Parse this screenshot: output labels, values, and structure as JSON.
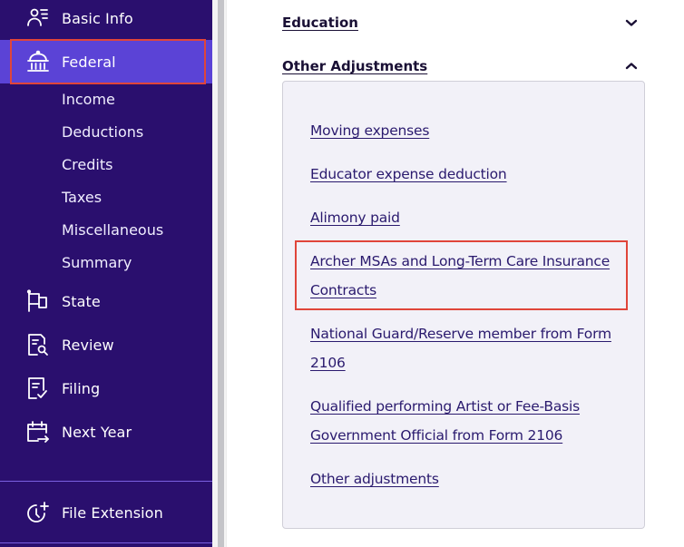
{
  "sidebar": {
    "items": [
      {
        "label": "Basic Info",
        "icon": "person-list-icon"
      },
      {
        "label": "Federal",
        "icon": "capitol-building-icon",
        "active": true
      },
      {
        "label": "State",
        "icon": "flag-icon"
      },
      {
        "label": "Review",
        "icon": "document-search-icon"
      },
      {
        "label": "Filing",
        "icon": "document-check-icon"
      },
      {
        "label": "Next Year",
        "icon": "calendar-arrow-icon"
      }
    ],
    "federal_subitems": [
      "Income",
      "Deductions",
      "Credits",
      "Taxes",
      "Miscellaneous",
      "Summary"
    ],
    "file_extension": {
      "label": "File Extension",
      "icon": "clock-plus-icon"
    }
  },
  "main": {
    "sections": [
      {
        "title": "Education",
        "expanded": false
      },
      {
        "title": "Other Adjustments",
        "expanded": true
      }
    ],
    "other_adjustments_links": [
      "Moving expenses",
      "Educator expense deduction",
      "Alimony paid",
      "Archer MSAs and Long-Term Care Insurance Contracts",
      "National Guard/Reserve member from Form 2106",
      "Qualified performing Artist or Fee-Basis Government Official from Form 2106",
      "Other adjustments"
    ],
    "highlighted_link_index": 3
  },
  "colors": {
    "sidebar_bg": "#2a0f6e",
    "active_bg": "#5b43d6",
    "highlight_border": "#e0453a",
    "link_color": "#2a1a6e",
    "panel_bg": "#f2f1f8"
  }
}
